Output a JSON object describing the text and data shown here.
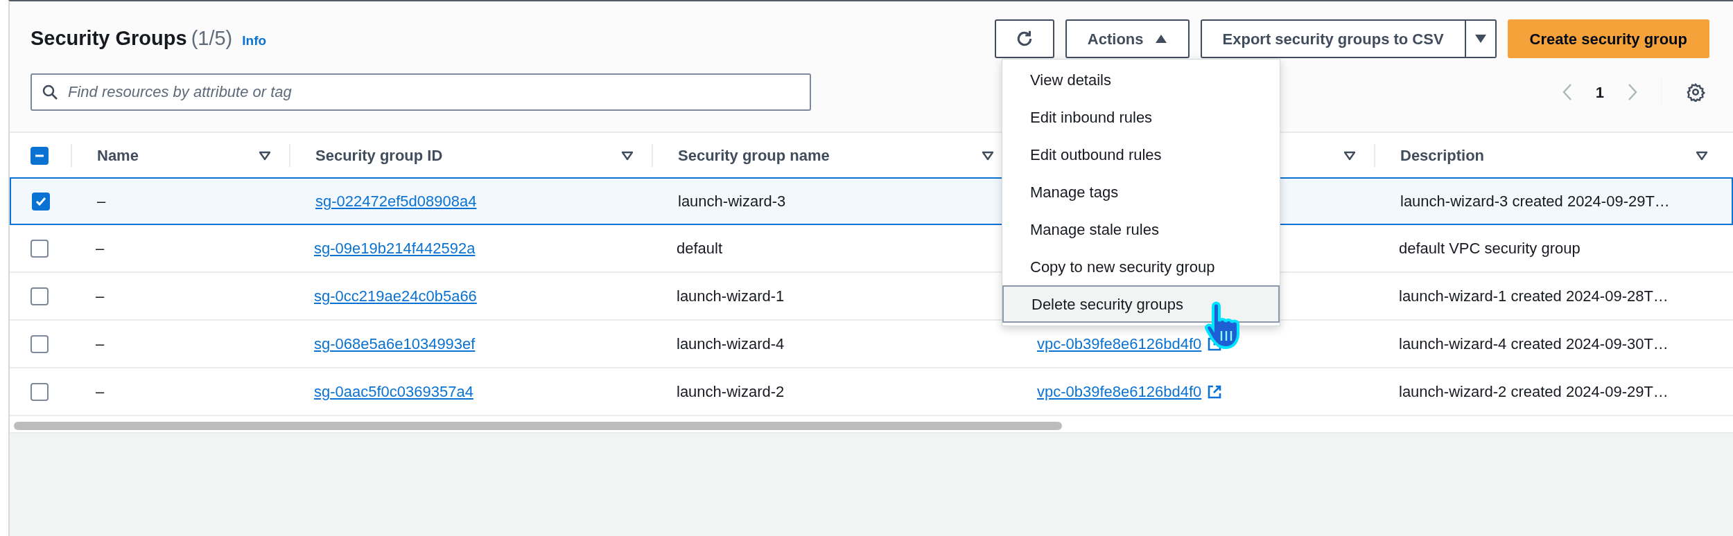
{
  "header": {
    "title": "Security Groups",
    "count": "(1/5)",
    "info_link": "Info"
  },
  "toolbar": {
    "actions": {
      "label": "Actions",
      "expanded": true
    },
    "export": {
      "label": "Export security groups to CSV"
    },
    "create": {
      "label": "Create security group"
    }
  },
  "search": {
    "placeholder": "Find resources by attribute or tag"
  },
  "pagination": {
    "current_page": "1"
  },
  "table": {
    "header_checkbox": {
      "indeterminate": true
    },
    "columns": [
      {
        "label": "Name",
        "sortable": true
      },
      {
        "label": "Security group ID",
        "sortable": true
      },
      {
        "label": "Security group name",
        "sortable": true
      },
      {
        "sortable": true
      },
      {
        "label": "Description",
        "sortable": true
      }
    ],
    "rows": [
      {
        "selected": true,
        "name": "–",
        "group_id": "sg-022472ef5d08908a4",
        "group_name": "launch-wizard-3",
        "description": "launch-wizard-3 created 2024-09-29T…"
      },
      {
        "selected": false,
        "name": "–",
        "group_id": "sg-09e19b214f442592a",
        "group_name": "default",
        "description": "default VPC security group"
      },
      {
        "selected": false,
        "name": "–",
        "group_id": "sg-0cc219ae24c0b5a66",
        "group_name": "launch-wizard-1",
        "description": "launch-wizard-1 created 2024-09-28T…"
      },
      {
        "selected": false,
        "name": "–",
        "group_id": "sg-068e5a6e1034993ef",
        "group_name": "launch-wizard-4",
        "vpc_id": "vpc-0b39fe8e6126bd4f0",
        "description": "launch-wizard-4 created 2024-09-30T…"
      },
      {
        "selected": false,
        "name": "–",
        "group_id": "sg-0aac5f0c0369357a4",
        "group_name": "launch-wizard-2",
        "vpc_id": "vpc-0b39fe8e6126bd4f0",
        "description": "launch-wizard-2 created 2024-09-29T…"
      }
    ]
  },
  "actions_menu": {
    "items": [
      {
        "label": "View details",
        "highlighted": false
      },
      {
        "label": "Edit inbound rules",
        "highlighted": false
      },
      {
        "label": "Edit outbound rules",
        "highlighted": false
      },
      {
        "label": "Manage tags",
        "highlighted": false
      },
      {
        "label": "Manage stale rules",
        "highlighted": false
      },
      {
        "label": "Copy to new security group",
        "highlighted": false
      },
      {
        "label": "Delete security groups",
        "highlighted": true
      }
    ]
  }
}
